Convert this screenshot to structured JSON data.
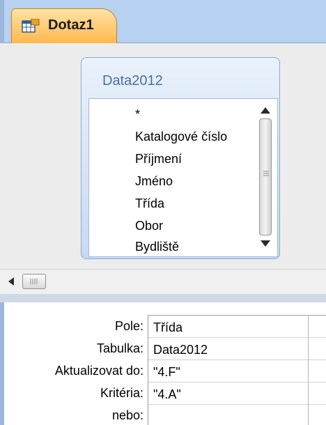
{
  "tab": {
    "label": "Dotaz1",
    "icon": "query-icon"
  },
  "field_window": {
    "title": "Data2012",
    "fields": [
      "*",
      "Katalogové číslo",
      "Příjmení",
      "Jméno",
      "Třída",
      "Obor",
      "Bydliště"
    ]
  },
  "grid": {
    "row_labels": [
      "Pole:",
      "Tabulka:",
      "Aktualizovat do:",
      "Kritéria:",
      "nebo:"
    ],
    "column1": [
      "Třída",
      "Data2012",
      "\"4.F\"",
      "\"4.A\"",
      ""
    ]
  },
  "colors": {
    "tab_gradient_top": "#ffe3a6",
    "tab_gradient_bottom": "#ffb84d",
    "frame_blue": "#b7d1f1"
  }
}
